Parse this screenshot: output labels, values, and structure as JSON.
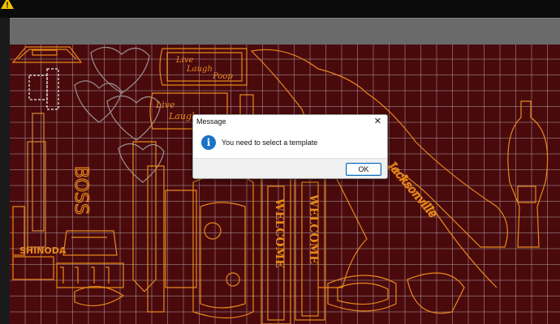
{
  "status": {
    "warning_icon": "warning-triangle-icon",
    "warning_glyph": "!"
  },
  "canvas": {
    "background_color": "#4a0a0c",
    "grid_color": "#aa96a0",
    "design_color": "#e8891a"
  },
  "designs": {
    "sign_live_laugh_poop": [
      "Live",
      "Laugh",
      "Poop"
    ],
    "sign_live_laugh": [
      "Live",
      "Laugh"
    ],
    "welcome_1": "WELCOME",
    "welcome_2": "WELCOME",
    "boss_vertical": "BOSS",
    "jacksonville": "Jacksonville",
    "shinoda": "SHINODA"
  },
  "dialog": {
    "title": "Message",
    "close_glyph": "✕",
    "icon_glyph": "i",
    "message": "You need to select a template",
    "ok_label": "OK"
  }
}
